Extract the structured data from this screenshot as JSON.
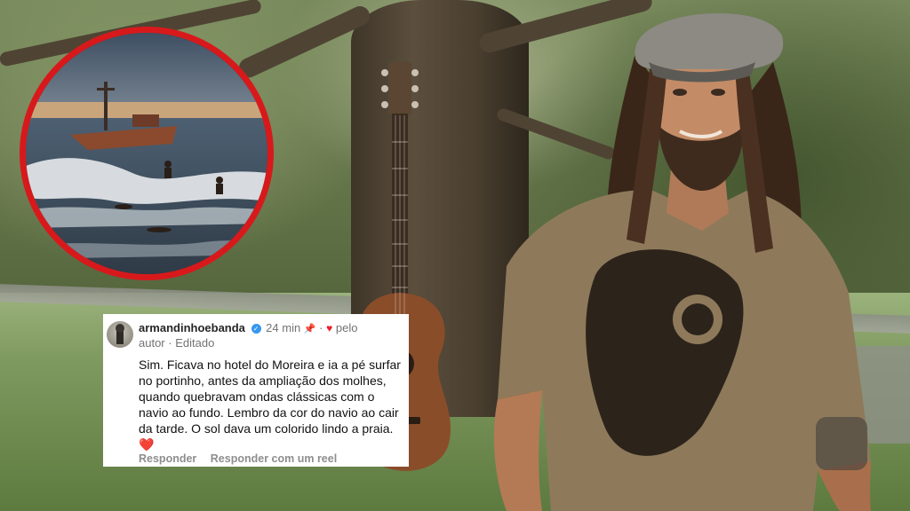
{
  "comment": {
    "username": "armandinhoebanda",
    "verified_icon": "verified-badge-icon",
    "time": "24 min",
    "pin_icon": "pin-icon",
    "heart_icon": "heart-icon",
    "liked_by": "pelo",
    "liked_by_2": "autor",
    "separator": "·",
    "edited": "Editado",
    "text": "Sim. Ficava no hotel do Moreira e ia a pé surfar no portinho, antes da ampliação dos molhes, quando quebravam ondas clássicas com o navio ao fundo. Lembro da cor do navio ao cair da tarde. O sol dava um colorido lindo a praia. ❤️",
    "reply_label": "Responder",
    "reply_reel_label": "Responder com um reel"
  },
  "colors": {
    "inset_border": "#d8191c",
    "verified": "#3797f0",
    "heart": "#ed1c2e"
  }
}
